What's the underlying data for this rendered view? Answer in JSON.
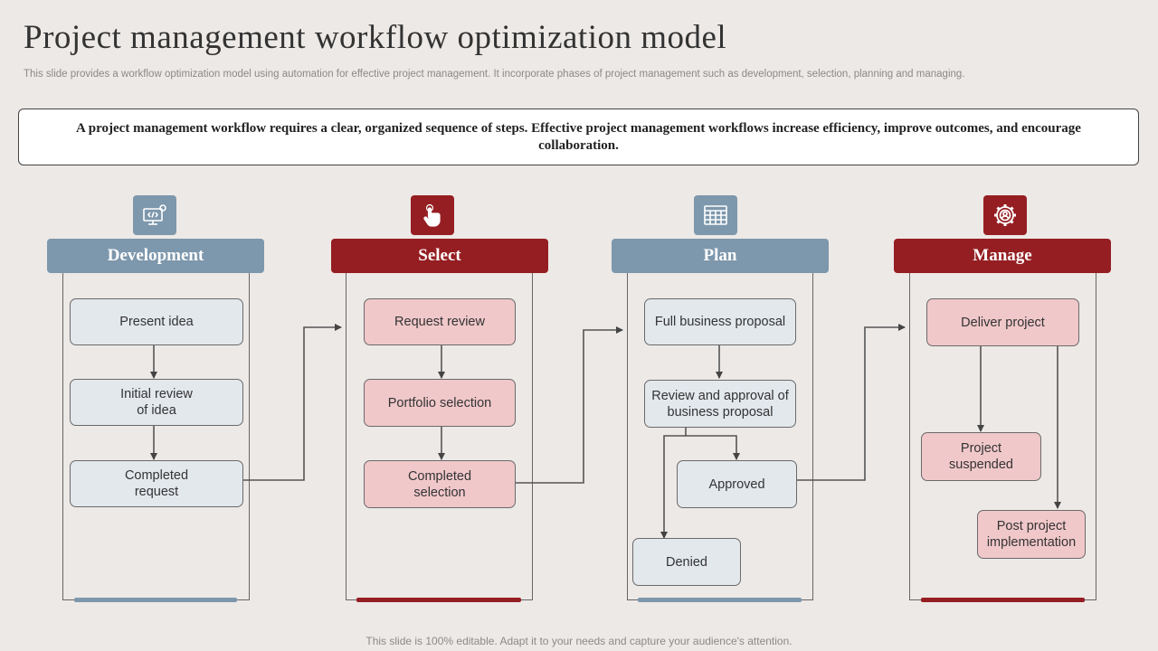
{
  "title": "Project management workflow optimization model",
  "subtitle": "This slide provides a workflow optimization model using automation for effective project management. It incorporate phases of project management such as development, selection, planning and managing.",
  "intro": "A project management workflow requires a clear, organized sequence of steps. Effective project management workflows increase efficiency, improve outcomes, and encourage collaboration.",
  "colors": {
    "blue": "#7d97ac",
    "red": "#951e22",
    "blue_box": "#e3e8ed",
    "pink_box": "#f1c8ca"
  },
  "phases": [
    {
      "label": "Development",
      "icon": "code-monitor-gear-icon",
      "steps": [
        "Present idea",
        "Initial review\nof idea",
        "Completed\nrequest"
      ]
    },
    {
      "label": "Select",
      "icon": "hand-pointer-icon",
      "steps": [
        "Request review",
        "Portfolio selection",
        "Completed\nselection"
      ]
    },
    {
      "label": "Plan",
      "icon": "calendar-grid-icon",
      "steps": [
        "Full business proposal",
        "Review and approval of\nbusiness proposal",
        "Approved",
        "Denied"
      ]
    },
    {
      "label": "Manage",
      "icon": "gear-person-icon",
      "steps": [
        "Deliver project",
        "Project\nsuspended",
        "Post project\nimplementation"
      ]
    }
  ],
  "footer": "This slide is 100% editable. Adapt it to your needs and capture your audience's attention."
}
